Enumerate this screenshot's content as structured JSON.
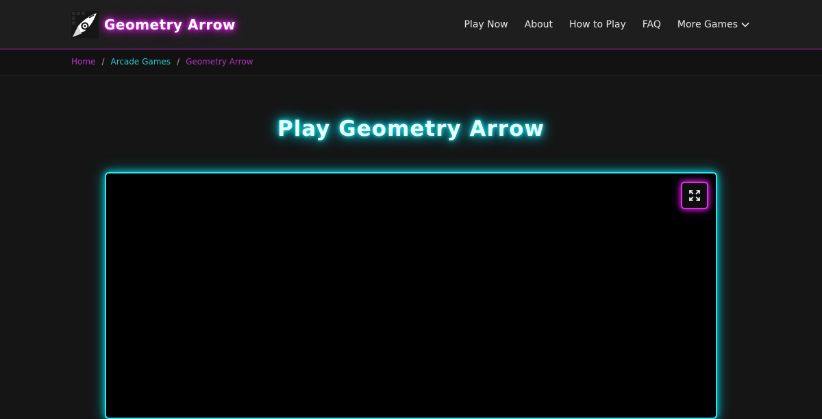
{
  "header": {
    "logo_text": "Geometry Arrow",
    "nav": [
      {
        "label": "Play Now"
      },
      {
        "label": "About"
      },
      {
        "label": "How to Play"
      },
      {
        "label": "FAQ"
      },
      {
        "label": "More Games",
        "icon": "chevron-down-icon"
      }
    ]
  },
  "breadcrumb": {
    "home": "Home",
    "section": "Arcade Games",
    "current": "Geometry Arrow",
    "separator": "/"
  },
  "main": {
    "title": "Play Geometry Arrow",
    "fullscreen_icon": "expand-icon"
  },
  "colors": {
    "accent_magenta": "#c21bd0",
    "accent_cyan": "#2ee6ec",
    "background": "#151515"
  }
}
